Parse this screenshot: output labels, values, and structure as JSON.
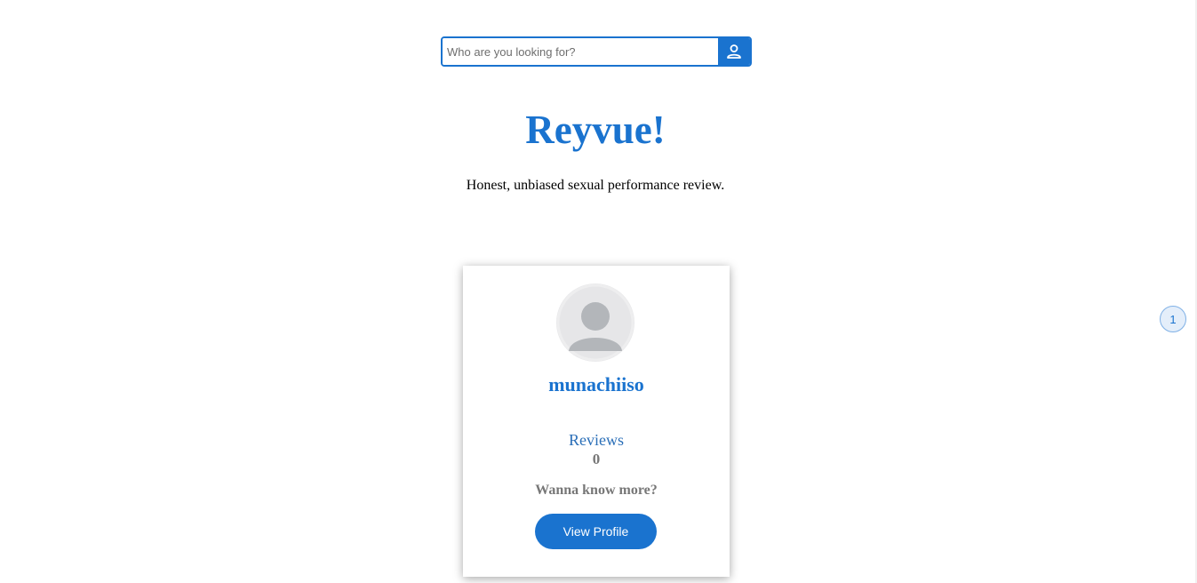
{
  "search": {
    "placeholder": "Who are you looking for?",
    "value": "",
    "button_icon": "user-icon"
  },
  "hero": {
    "title": "Reyvue!",
    "tagline": "Honest, unbiased sexual performance review."
  },
  "profile_card": {
    "avatar_icon": "default-avatar-icon",
    "username": "munachiiso",
    "reviews_label": "Reviews",
    "reviews_count": "0",
    "more_text": "Wanna know more?",
    "button_label": "View Profile"
  },
  "pagination": {
    "current_page": "1"
  },
  "colors": {
    "accent": "#1a73cf",
    "muted_text": "#777777",
    "avatar_bg": "#e6e6e8",
    "avatar_fg": "#b3b6ba"
  }
}
